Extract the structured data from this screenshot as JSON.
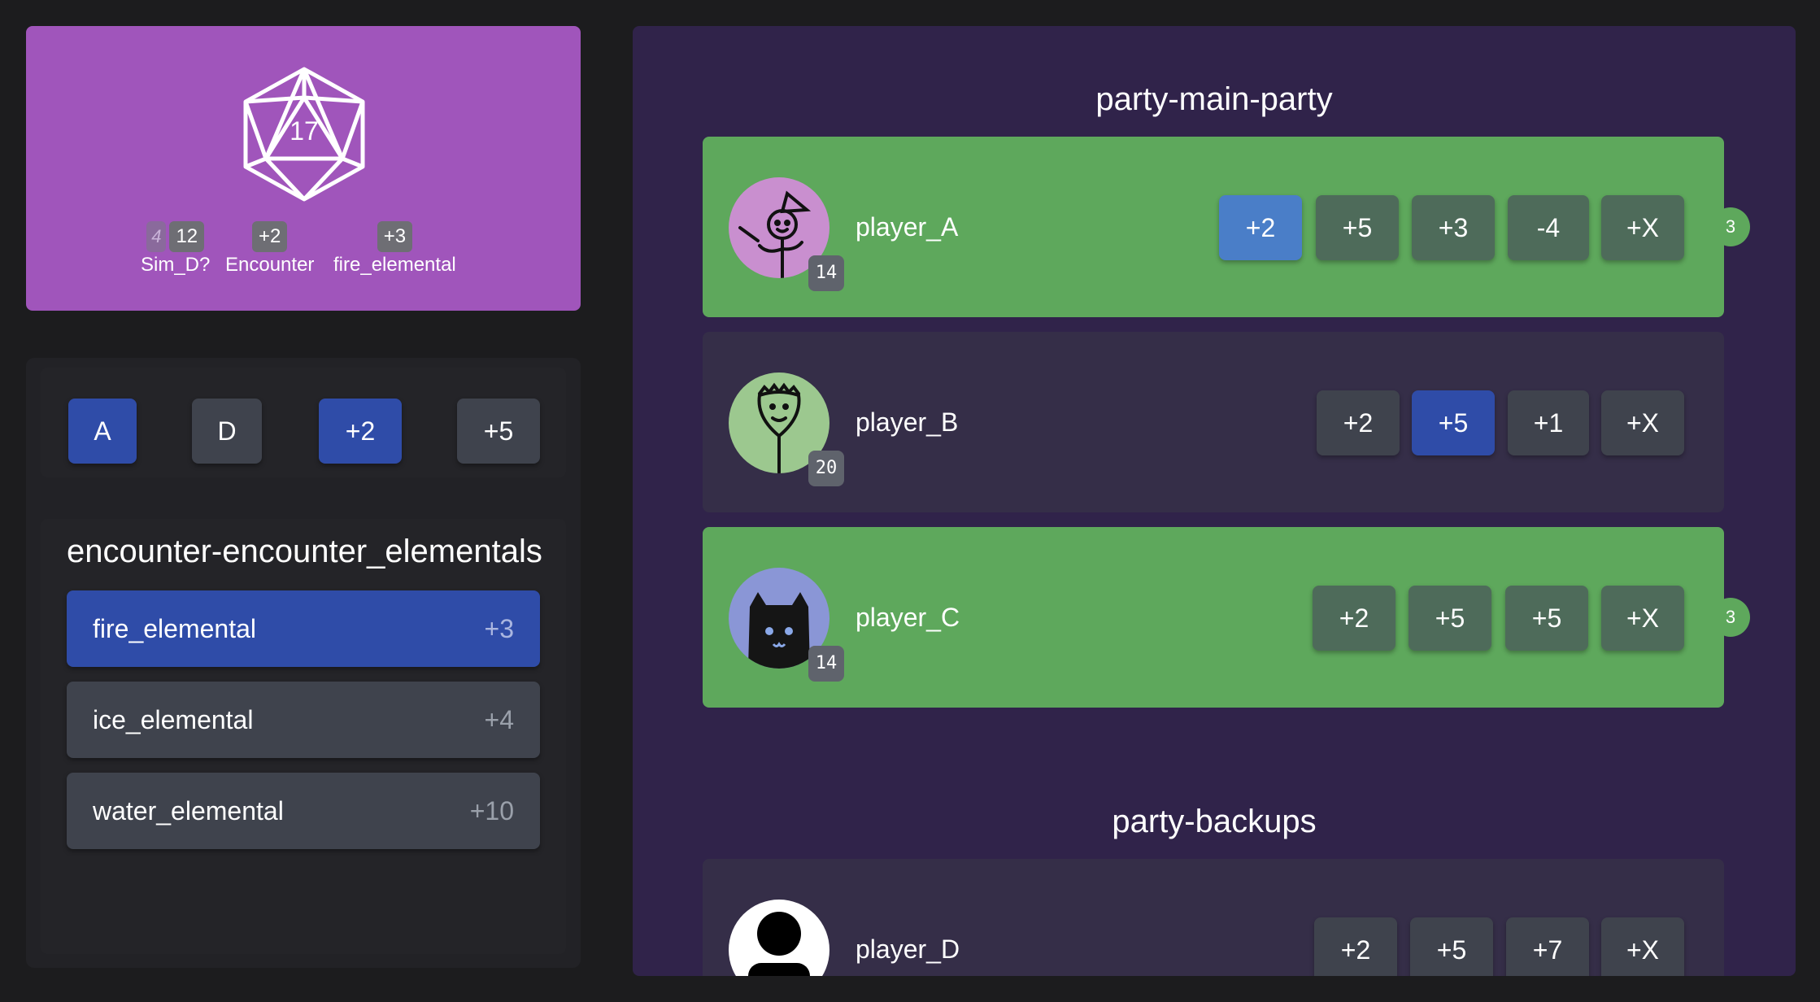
{
  "dice": {
    "face_value": "17",
    "stats": [
      {
        "chip_faint": "4",
        "chip": "12",
        "label": "Sim_D?"
      },
      {
        "chip": "+2",
        "label": "Encounter"
      },
      {
        "chip": "+3",
        "label": "fire_elemental"
      }
    ]
  },
  "controls": {
    "buttons": [
      "A",
      "D",
      "+2",
      "+5"
    ]
  },
  "encounter": {
    "title": "encounter-encounter_elementals",
    "enemies": [
      {
        "name": "fire_elemental",
        "mod": "+3"
      },
      {
        "name": "ice_elemental",
        "mod": "+4"
      },
      {
        "name": "water_elemental",
        "mod": "+10"
      }
    ]
  },
  "main_party": {
    "title": "party-main-party",
    "players": [
      {
        "name": "player_A",
        "level": "14",
        "mods": [
          "+2",
          "+5",
          "+3",
          "-4",
          "+X"
        ],
        "count": "3"
      },
      {
        "name": "player_B",
        "level": "20",
        "mods": [
          "+2",
          "+5",
          "+1",
          "+X"
        ]
      },
      {
        "name": "player_C",
        "level": "14",
        "mods": [
          "+2",
          "+5",
          "+5",
          "+X"
        ],
        "count": "3"
      }
    ]
  },
  "backups": {
    "title": "party-backups",
    "players": [
      {
        "name": "player_D",
        "mods": [
          "+2",
          "+5",
          "+7",
          "+X"
        ]
      }
    ]
  },
  "colors": {
    "dice_card": "#a055bb",
    "active_blue": "#2f4ca8",
    "party_green": "#5ea85c",
    "party_panel": "#30234a"
  }
}
